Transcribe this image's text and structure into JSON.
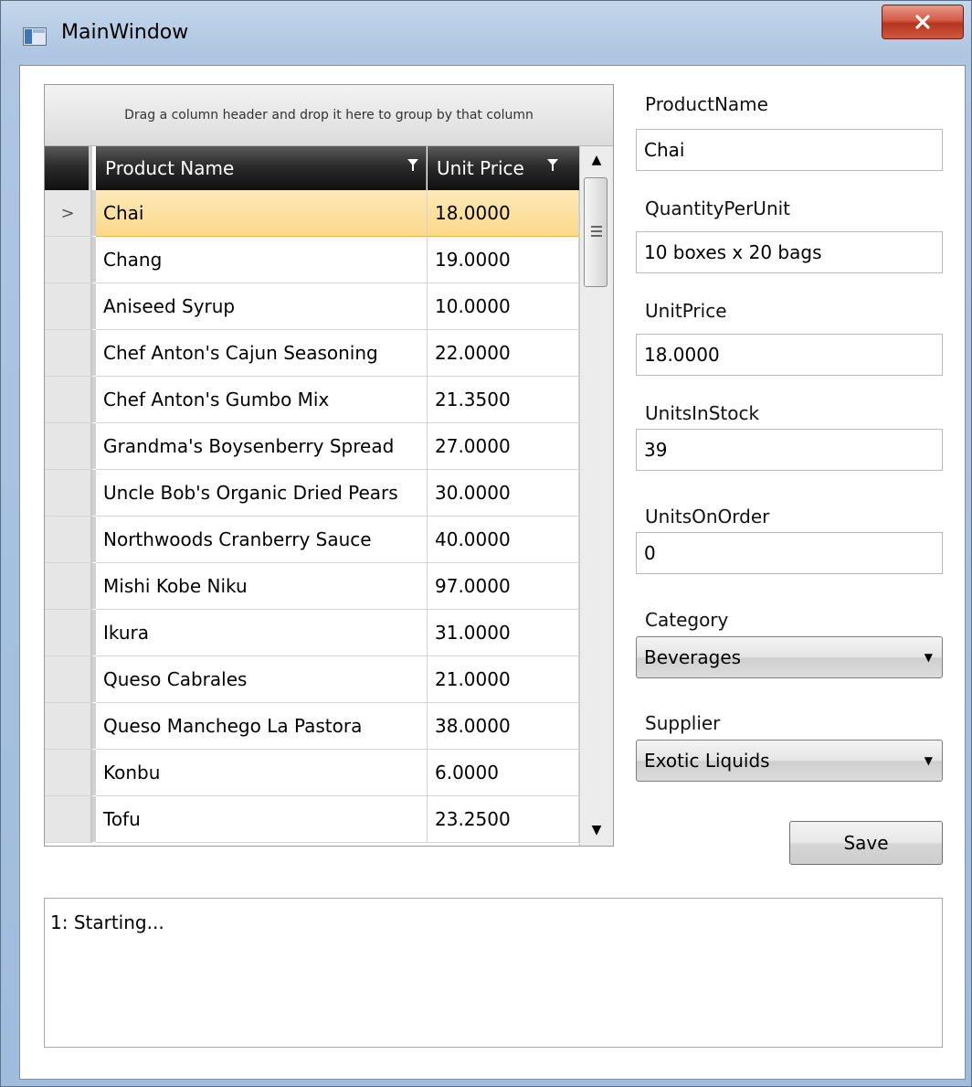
{
  "window": {
    "title": "MainWindow",
    "close_label": "x"
  },
  "grid": {
    "group_hint": "Drag a column header and drop it here to group by that column",
    "columns": [
      "Product Name",
      "Unit Price"
    ],
    "current_row_marker": ">",
    "rows": [
      {
        "name": "Chai",
        "price": "18.0000",
        "selected": true
      },
      {
        "name": "Chang",
        "price": "19.0000"
      },
      {
        "name": "Aniseed Syrup",
        "price": "10.0000"
      },
      {
        "name": "Chef Anton's Cajun Seasoning",
        "price": "22.0000"
      },
      {
        "name": "Chef Anton's Gumbo Mix",
        "price": "21.3500"
      },
      {
        "name": "Grandma's Boysenberry Spread",
        "price": "27.0000"
      },
      {
        "name": "Uncle Bob's Organic Dried Pears",
        "price": "30.0000"
      },
      {
        "name": "Northwoods Cranberry Sauce",
        "price": "40.0000"
      },
      {
        "name": "Mishi Kobe Niku",
        "price": "97.0000"
      },
      {
        "name": "Ikura",
        "price": "31.0000"
      },
      {
        "name": "Queso Cabrales",
        "price": "21.0000"
      },
      {
        "name": "Queso Manchego La Pastora",
        "price": "38.0000"
      },
      {
        "name": "Konbu",
        "price": "6.0000"
      },
      {
        "name": "Tofu",
        "price": "23.2500"
      }
    ]
  },
  "form": {
    "product_name": {
      "label": "ProductName",
      "value": "Chai"
    },
    "quantity_per_unit": {
      "label": "QuantityPerUnit",
      "value": "10 boxes x 20 bags"
    },
    "unit_price": {
      "label": "UnitPrice",
      "value": "18.0000"
    },
    "units_in_stock": {
      "label": "UnitsInStock",
      "value": "39"
    },
    "units_on_order": {
      "label": "UnitsOnOrder",
      "value": "0"
    },
    "category": {
      "label": "Category",
      "selected": "Beverages"
    },
    "supplier": {
      "label": "Supplier",
      "selected": "Exotic Liquids"
    },
    "save_label": "Save"
  },
  "log": {
    "text": "1: Starting..."
  },
  "icons": {
    "app": "window-icon",
    "filter": "filter-icon",
    "scroll_up": "scroll-up-arrow-icon",
    "scroll_down": "scroll-down-arrow-icon",
    "dropdown": "chevron-down-icon"
  }
}
